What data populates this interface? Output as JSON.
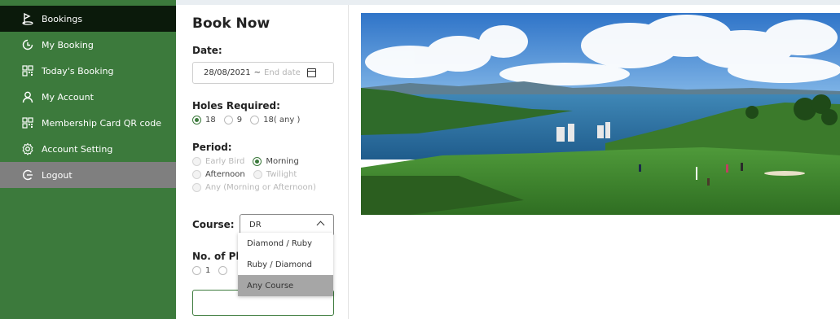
{
  "sidebar": {
    "items": [
      {
        "label": "Bookings",
        "icon": "golf-flag-icon",
        "active": true
      },
      {
        "label": "My Booking",
        "icon": "clock-icon"
      },
      {
        "label": "Today's Booking",
        "icon": "qr-code-icon"
      },
      {
        "label": "My Account",
        "icon": "user-icon"
      },
      {
        "label": "Membership Card QR code",
        "icon": "qr-code-icon"
      },
      {
        "label": "Account Setting",
        "icon": "gear-icon"
      },
      {
        "label": "Logout",
        "icon": "logout-icon"
      }
    ]
  },
  "booking": {
    "title": "Book Now",
    "date_label": "Date:",
    "start_date": "28/08/2021",
    "date_separator": "~",
    "end_date_placeholder": "End date",
    "holes_label": "Holes Required:",
    "holes_options": [
      "18",
      "9",
      "18( any )"
    ],
    "holes_selected": "18",
    "period_label": "Period:",
    "period_options": [
      "Early Bird",
      "Morning",
      "Afternoon",
      "Twilight",
      "Any (Morning or Afternoon)"
    ],
    "period_selected": "Morning",
    "course_label": "Course:",
    "course_value": "DR",
    "course_options": [
      "Diamond / Ruby",
      "Ruby / Diamond",
      "Any Course"
    ],
    "course_highlighted": "Any Course",
    "players_label": "No. of Pla",
    "players_options": [
      "1"
    ]
  },
  "colors": {
    "sidebar_bg": "#3c7a3c",
    "active_bg": "#0b1a0b",
    "logout_bg": "#7f7f7f",
    "accent": "#3c7a3c"
  }
}
